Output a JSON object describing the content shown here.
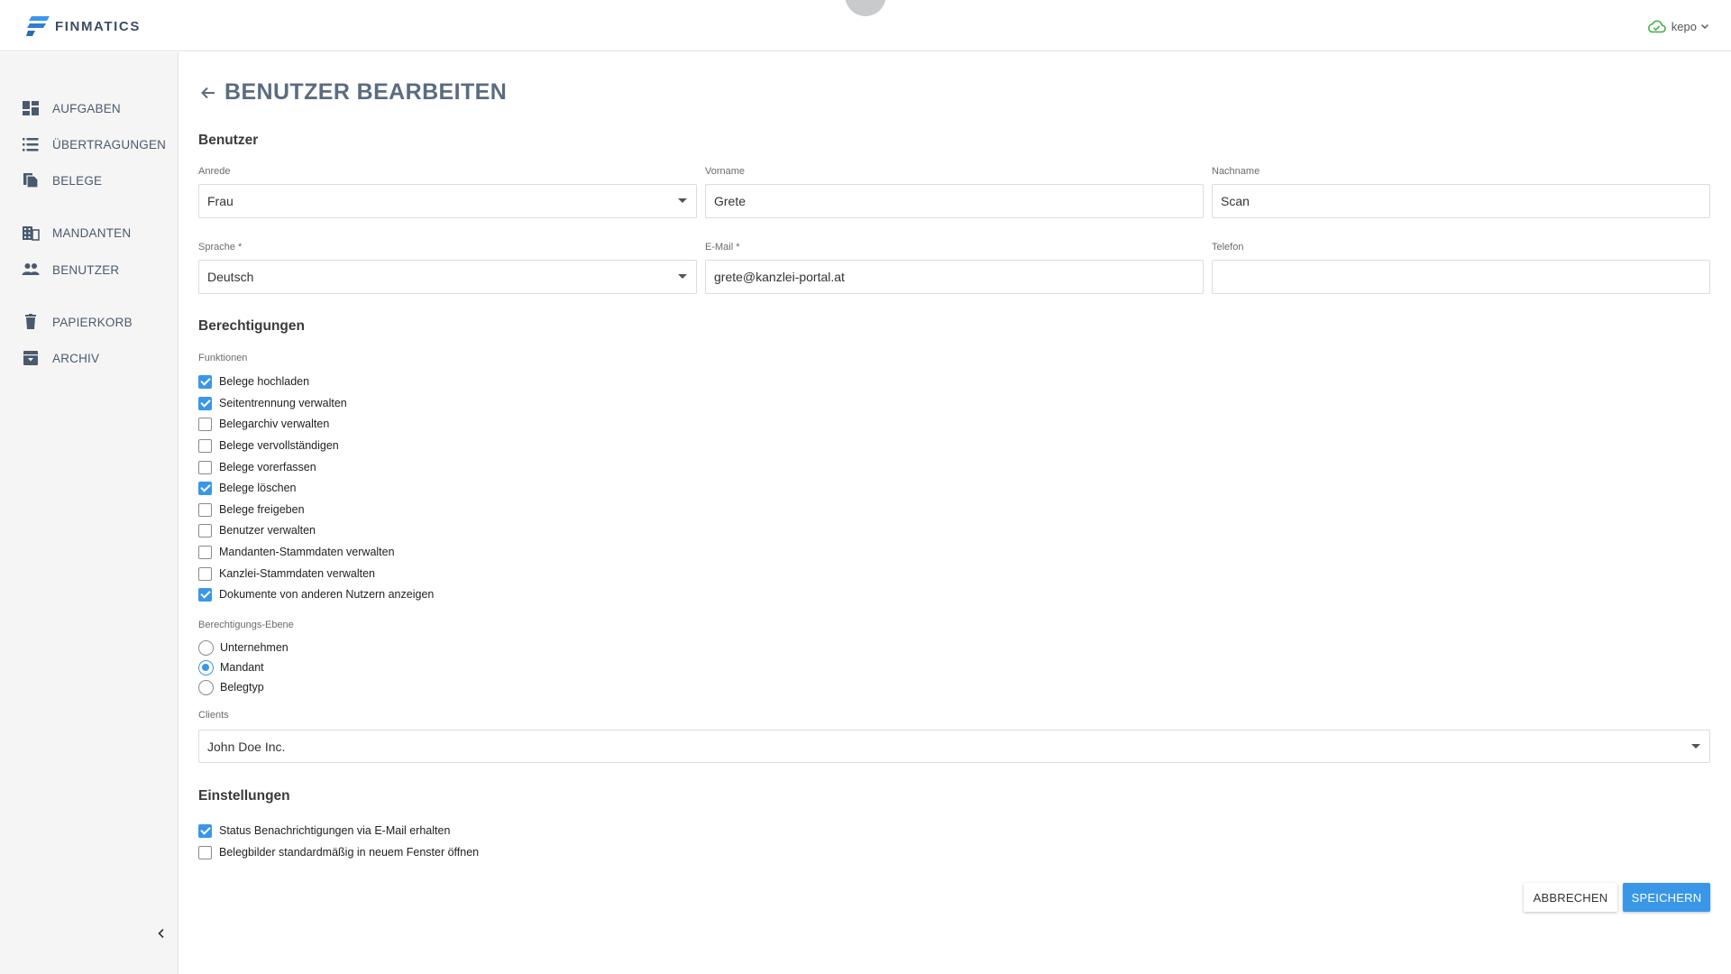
{
  "app": {
    "brand": "FINMATICS",
    "accent_color": "#3a97e8",
    "check_color": "#3a97e8"
  },
  "user_menu": {
    "username": "kepo",
    "status_icon": "cloud-check-icon",
    "status_color": "#4caf50"
  },
  "sidebar": {
    "items": [
      {
        "label": "AUFGABEN",
        "icon": "dashboard-icon"
      },
      {
        "label": "ÜBERTRAGUNGEN",
        "icon": "list-icon"
      },
      {
        "label": "BELEGE",
        "icon": "documents-icon"
      },
      {
        "label": "MANDANTEN",
        "icon": "building-icon"
      },
      {
        "label": "BENUTZER",
        "icon": "people-icon"
      },
      {
        "label": "PAPIERKORB",
        "icon": "trash-icon"
      },
      {
        "label": "ARCHIV",
        "icon": "archive-icon"
      }
    ]
  },
  "page": {
    "title": "BENUTZER BEARBEITEN"
  },
  "user_section": {
    "title": "Benutzer",
    "salutation": {
      "label": "Anrede",
      "value": "Frau"
    },
    "first_name": {
      "label": "Vorname",
      "value": "Grete"
    },
    "last_name": {
      "label": "Nachname",
      "value": "Scan"
    },
    "language": {
      "label": "Sprache *",
      "value": "Deutsch"
    },
    "email": {
      "label": "E-Mail *",
      "value": "grete@kanzlei-portal.at"
    },
    "phone": {
      "label": "Telefon",
      "value": ""
    }
  },
  "permissions": {
    "title": "Berechtigungen",
    "functions_label": "Funktionen",
    "functions": [
      {
        "label": "Belege hochladen",
        "checked": true
      },
      {
        "label": "Seitentrennung verwalten",
        "checked": true
      },
      {
        "label": "Belegarchiv verwalten",
        "checked": false
      },
      {
        "label": "Belege vervollständigen",
        "checked": false
      },
      {
        "label": "Belege vorerfassen",
        "checked": false
      },
      {
        "label": "Belege löschen",
        "checked": true
      },
      {
        "label": "Belege freigeben",
        "checked": false
      },
      {
        "label": "Benutzer verwalten",
        "checked": false
      },
      {
        "label": "Mandanten-Stammdaten verwalten",
        "checked": false
      },
      {
        "label": "Kanzlei-Stammdaten verwalten",
        "checked": false
      },
      {
        "label": "Dokumente von anderen Nutzern anzeigen",
        "checked": true
      }
    ],
    "level_label": "Berechtigungs-Ebene",
    "levels": [
      {
        "label": "Unternehmen",
        "selected": false
      },
      {
        "label": "Mandant",
        "selected": true
      },
      {
        "label": "Belegtyp",
        "selected": false
      }
    ],
    "clients": {
      "label": "Clients",
      "value": "John Doe Inc."
    }
  },
  "settings": {
    "title": "Einstellungen",
    "options": [
      {
        "label": "Status Benachrichtigungen via E-Mail erhalten",
        "checked": true
      },
      {
        "label": "Belegbilder standardmäßig in neuem Fenster öffnen",
        "checked": false
      }
    ]
  },
  "actions": {
    "cancel_label": "ABBRECHEN",
    "save_label": "SPEICHERN"
  }
}
